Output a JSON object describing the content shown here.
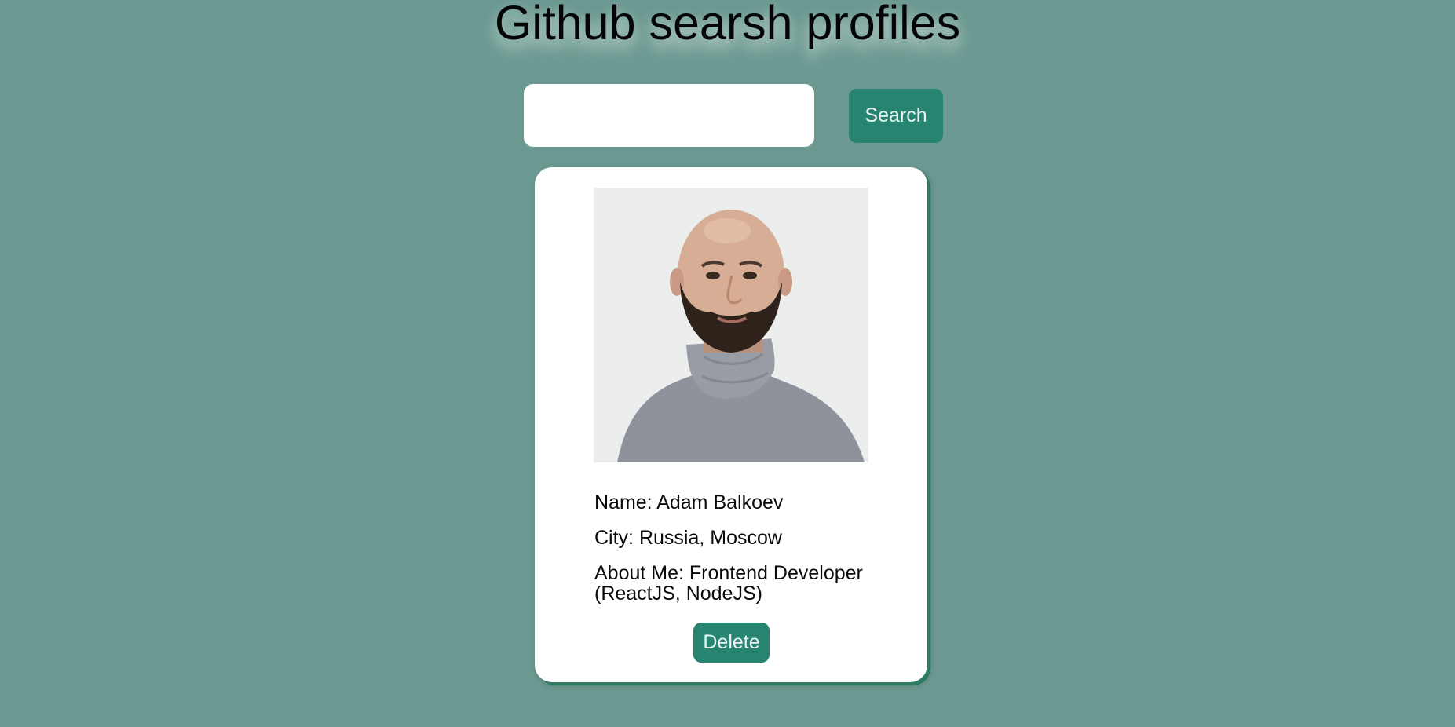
{
  "page": {
    "title": "Github searsh profiles"
  },
  "search": {
    "value": "",
    "placeholder": "",
    "button_label": "Search"
  },
  "profile_card": {
    "avatar_alt": "profile photo",
    "name_line": "Name: Adam Balkoev",
    "city_line": "City: Russia, Moscow",
    "about_line": "About Me: Frontend Developer (ReactJS, NodeJS)",
    "delete_label": "Delete"
  },
  "colors": {
    "background": "#6b9991",
    "accent": "#268470",
    "card": "#ffffff",
    "card_shadow": "#2e7a62"
  }
}
